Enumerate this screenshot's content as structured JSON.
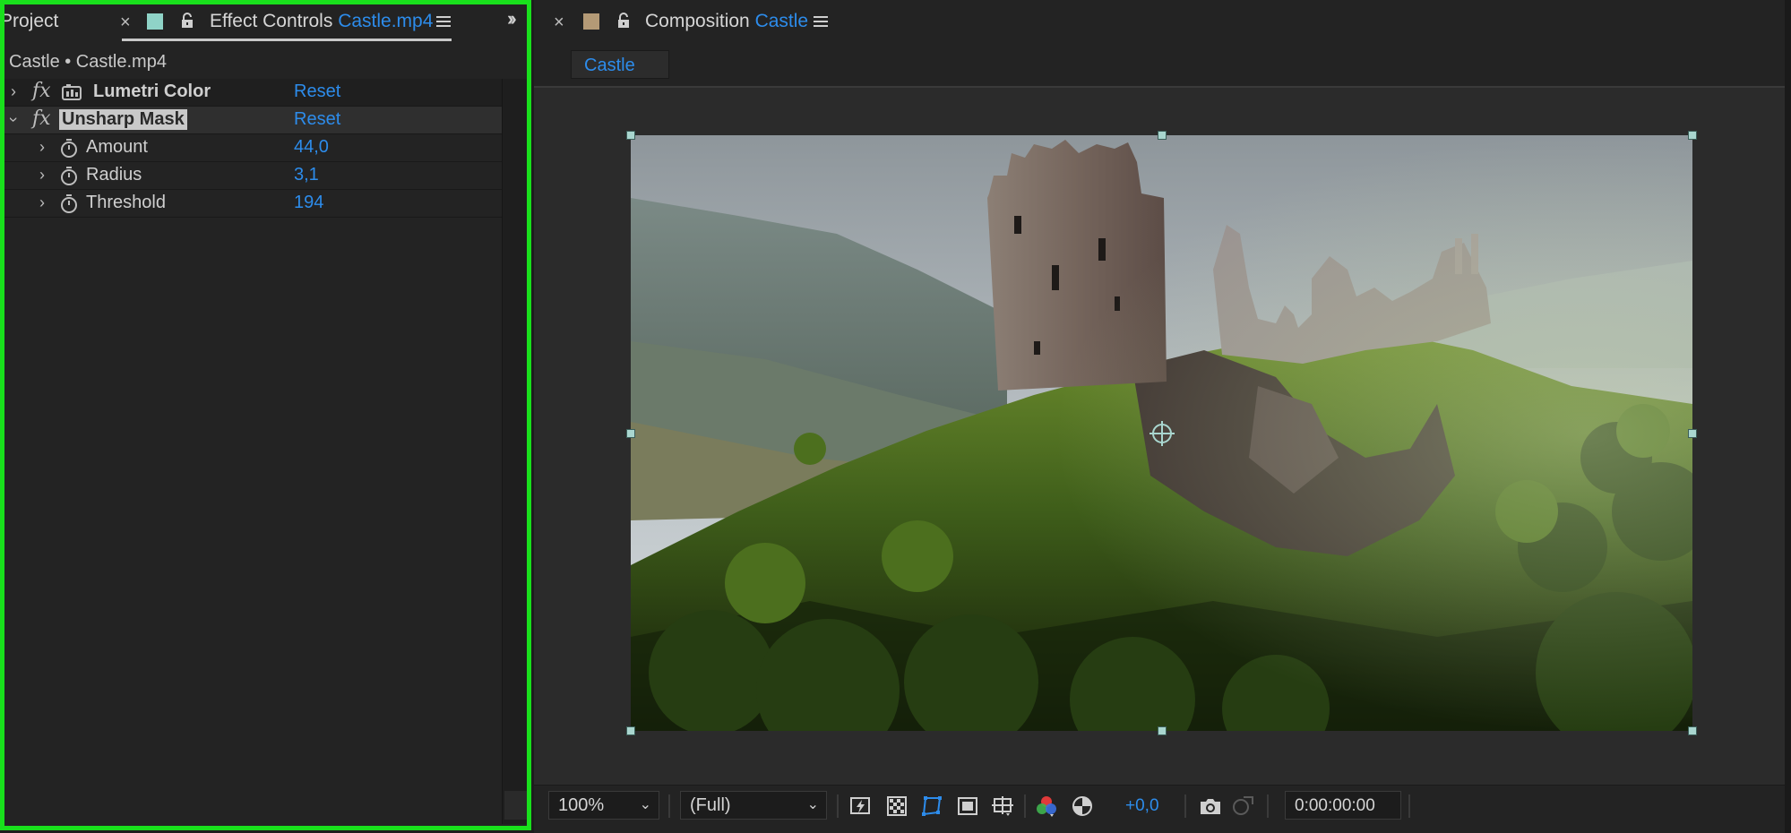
{
  "left_panel": {
    "tabs": {
      "project_label": "Project",
      "effect_controls_label": "Effect Controls",
      "effect_controls_file": "Castle.mp4",
      "swatch_color": "#8fd3c7"
    },
    "breadcrumb": "Castle • Castle.mp4",
    "effects": [
      {
        "name": "Lumetri Color",
        "reset_label": "Reset",
        "expanded": false
      },
      {
        "name": "Unsharp Mask",
        "reset_label": "Reset",
        "expanded": true
      }
    ],
    "properties": [
      {
        "label": "Amount",
        "value": "44,0"
      },
      {
        "label": "Radius",
        "value": "3,1"
      },
      {
        "label": "Threshold",
        "value": "194"
      }
    ]
  },
  "composition_panel": {
    "tab_prefix": "Composition",
    "tab_name": "Castle",
    "swatch_color": "#b49a76",
    "comp_button_label": "Castle",
    "toolbar": {
      "zoom": "100%",
      "resolution": "(Full)",
      "exposure": "+0,0",
      "timecode": "0:00:00:00"
    }
  },
  "colors": {
    "accent_blue": "#2d8ceb",
    "highlight_green": "#19e01c",
    "panel_bg": "#232323"
  }
}
